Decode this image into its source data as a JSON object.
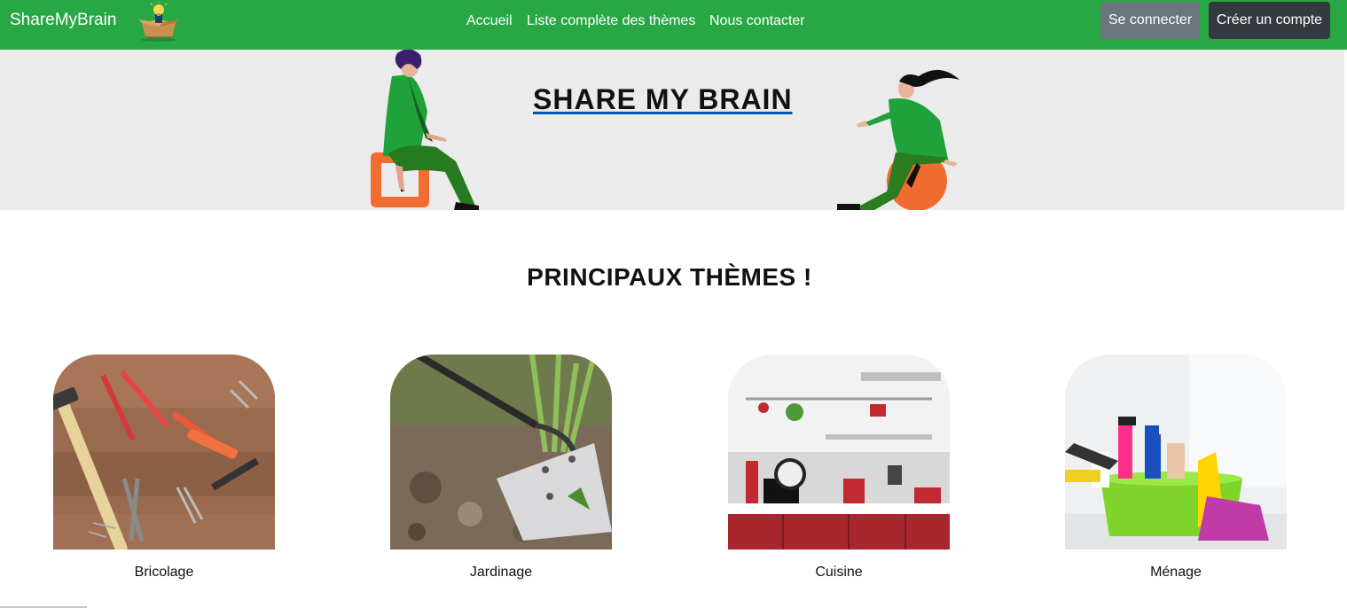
{
  "navbar": {
    "brand": "ShareMyBrain",
    "links": [
      "Accueil",
      "Liste complète des thèmes",
      "Nous contacter"
    ],
    "login_label": "Se connecter",
    "signup_label": "Créer un compte",
    "color": "#28a745"
  },
  "hero": {
    "title": "SHARE MY BRAIN",
    "background": "#ebebeb"
  },
  "themes_section": {
    "title": "PRINCIPAUX THÈMES !",
    "themes": [
      {
        "label": "Bricolage",
        "icon": "tools-photo"
      },
      {
        "label": "Jardinage",
        "icon": "garden-hoe-photo"
      },
      {
        "label": "Cuisine",
        "icon": "kitchen-photo"
      },
      {
        "label": "Ménage",
        "icon": "cleaning-supplies-photo"
      }
    ]
  },
  "colors": {
    "accent_orange": "#f26b2f",
    "figure_green": "#1fa23a",
    "login_button": "#6c757d",
    "signup_button": "#343a40"
  }
}
